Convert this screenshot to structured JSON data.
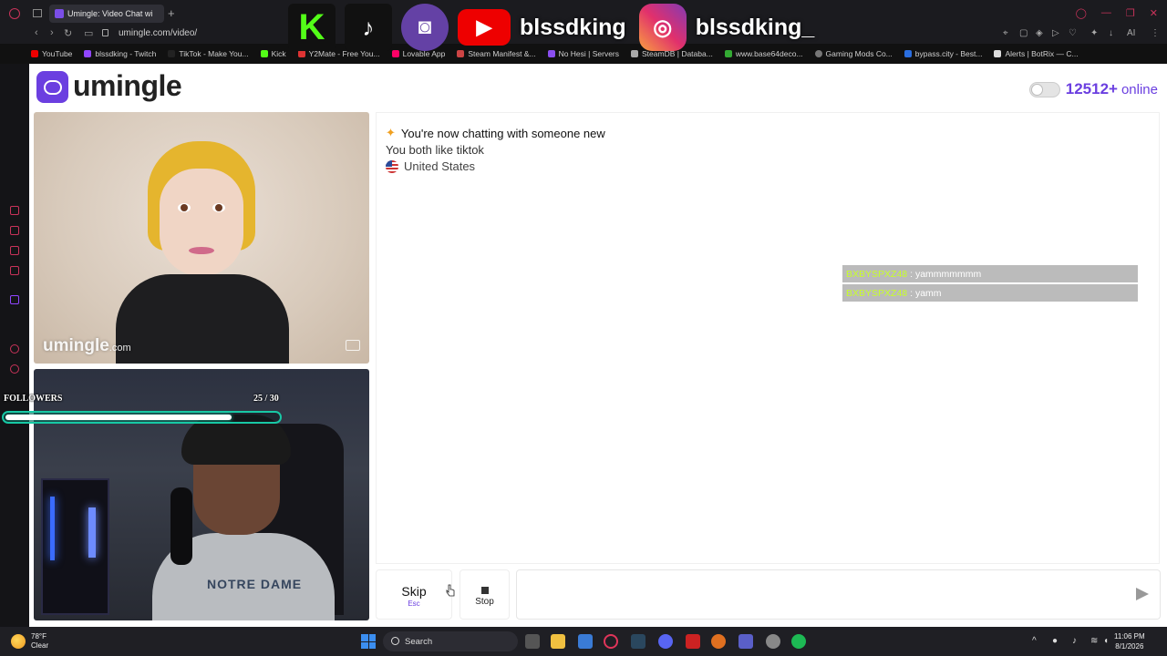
{
  "browser": {
    "tab_title": "Umingle: Video Chat wi",
    "url": "umingle.com/video/",
    "bookmarks": [
      "YouTube",
      "blssdking - Twitch",
      "TikTok - Make You...",
      "Kick",
      "Y2Mate - Free You...",
      "Lovable App",
      "Steam Manifest &...",
      "No Hesi | Servers",
      "SteamDB | Databa...",
      "www.base64deco...",
      "Gaming Mods Co...",
      "bypass.city - Best...",
      "Alerts | BotRix — C..."
    ]
  },
  "overlay": {
    "handle_main": "blssdking",
    "handle_instagram": "blssdking_",
    "followers_label": "FOLLOWERS",
    "followers_count": "25 / 30",
    "followers_progress": 0.83
  },
  "header": {
    "logo": "umingle",
    "online_count": "12512+",
    "online_label": "online"
  },
  "video": {
    "watermark": "umingle",
    "watermark_suffix": ".com",
    "shirt_text": "NOTRE DAME"
  },
  "chat": {
    "intro": "You're now chatting with someone new",
    "common": "You both like tiktok",
    "country": "United States"
  },
  "stream_chat": [
    {
      "user": "BXBYSPXZ48",
      "text": ": yammmmmmm"
    },
    {
      "user": "BXBYSPXZ48",
      "text": ": yamm"
    }
  ],
  "controls": {
    "skip_label": "Skip",
    "skip_key": "Esc",
    "stop_label": "Stop",
    "input_value": ""
  },
  "taskbar": {
    "temp": "78°F",
    "condition": "Clear",
    "search": "Search",
    "time": "11:06 PM",
    "date": "8/1/2026"
  },
  "colors": {
    "accent": "#6b3fe0",
    "progress": "#18c8a5",
    "chat_user": "#c8ff2a"
  }
}
